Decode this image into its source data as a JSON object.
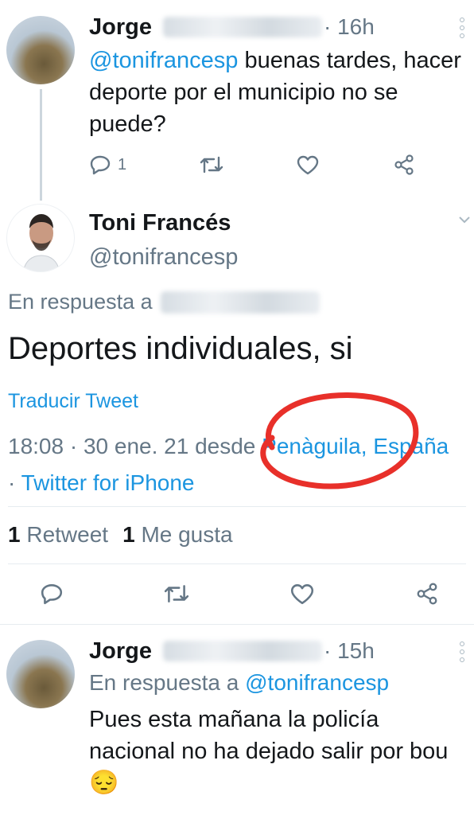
{
  "tweet1": {
    "name": "Jorge",
    "time": "· 16h",
    "mention": "@tonifrancesp",
    "text_after_mention": " buenas tardes, hacer deporte por el municipio no se puede?",
    "reply_count": "1"
  },
  "main_tweet": {
    "name": "Toni Francés",
    "handle": "@tonifrancesp",
    "reply_prefix": "En respuesta a",
    "text": "Deportes individuales, si",
    "translate": "Traducir Tweet",
    "meta_time": "18:08 · 30 ene. 21 desde ",
    "location": "Penàguila, España",
    "meta_sep": " · ",
    "source": "Twitter for iPhone",
    "retweet_count": "1",
    "retweet_label": "Retweet",
    "like_count": "1",
    "like_label": "Me gusta"
  },
  "tweet3": {
    "name": "Jorge",
    "time": "· 15h",
    "reply_prefix": "En respuesta a",
    "reply_to": "@tonifrancesp",
    "text": "Pues esta mañana la policía nacional no ha dejado salir por bou",
    "emoji": "😔"
  },
  "colors": {
    "link": "#1b95e0",
    "secondary": "#657786",
    "annotation": "#e8302a"
  },
  "icons": [
    "reply-icon",
    "retweet-icon",
    "like-icon",
    "share-icon",
    "more-icon",
    "chevron-down-icon"
  ]
}
